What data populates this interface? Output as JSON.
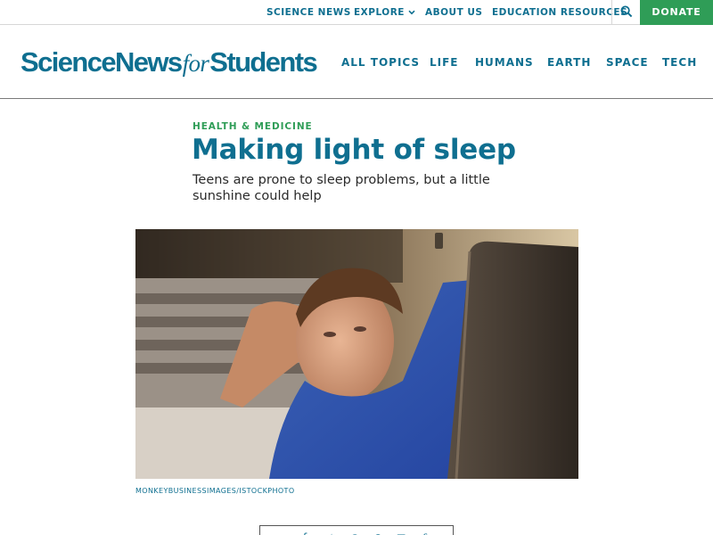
{
  "topbar": {
    "links": {
      "science_news": "SCIENCE NEWS",
      "explore": "EXPLORE",
      "about_us": "ABOUT US",
      "education_resources": "EDUCATION RESOURCES"
    },
    "donate": "DONATE",
    "icons": {
      "search": "search-icon",
      "explore_chevron": "chevron-down-icon"
    }
  },
  "header": {
    "logo": {
      "part1": "ScienceNews",
      "part2": "for",
      "part3": "Students"
    },
    "nav": {
      "all_topics": "ALL TOPICS",
      "life": "LIFE",
      "humans": "HUMANS",
      "earth": "EARTH",
      "space": "SPACE",
      "tech": "TECH"
    }
  },
  "article": {
    "kicker": "HEALTH & MEDICINE",
    "headline": "Making light of sleep",
    "dek": "Teens are prone to sleep problems, but a little sunshine could help",
    "image_credit": "MONKEYBUSINESSIMAGES/ISTOCKPHOTO"
  },
  "share": {
    "icons": [
      "facebook-icon",
      "twitter-icon",
      "pinterest-icon",
      "reddit-icon",
      "email-icon",
      "print-icon"
    ]
  },
  "colors": {
    "brand_blue": "#0f6f90",
    "accent_green": "#2f9d57",
    "border_gray": "#d7d7d7"
  }
}
